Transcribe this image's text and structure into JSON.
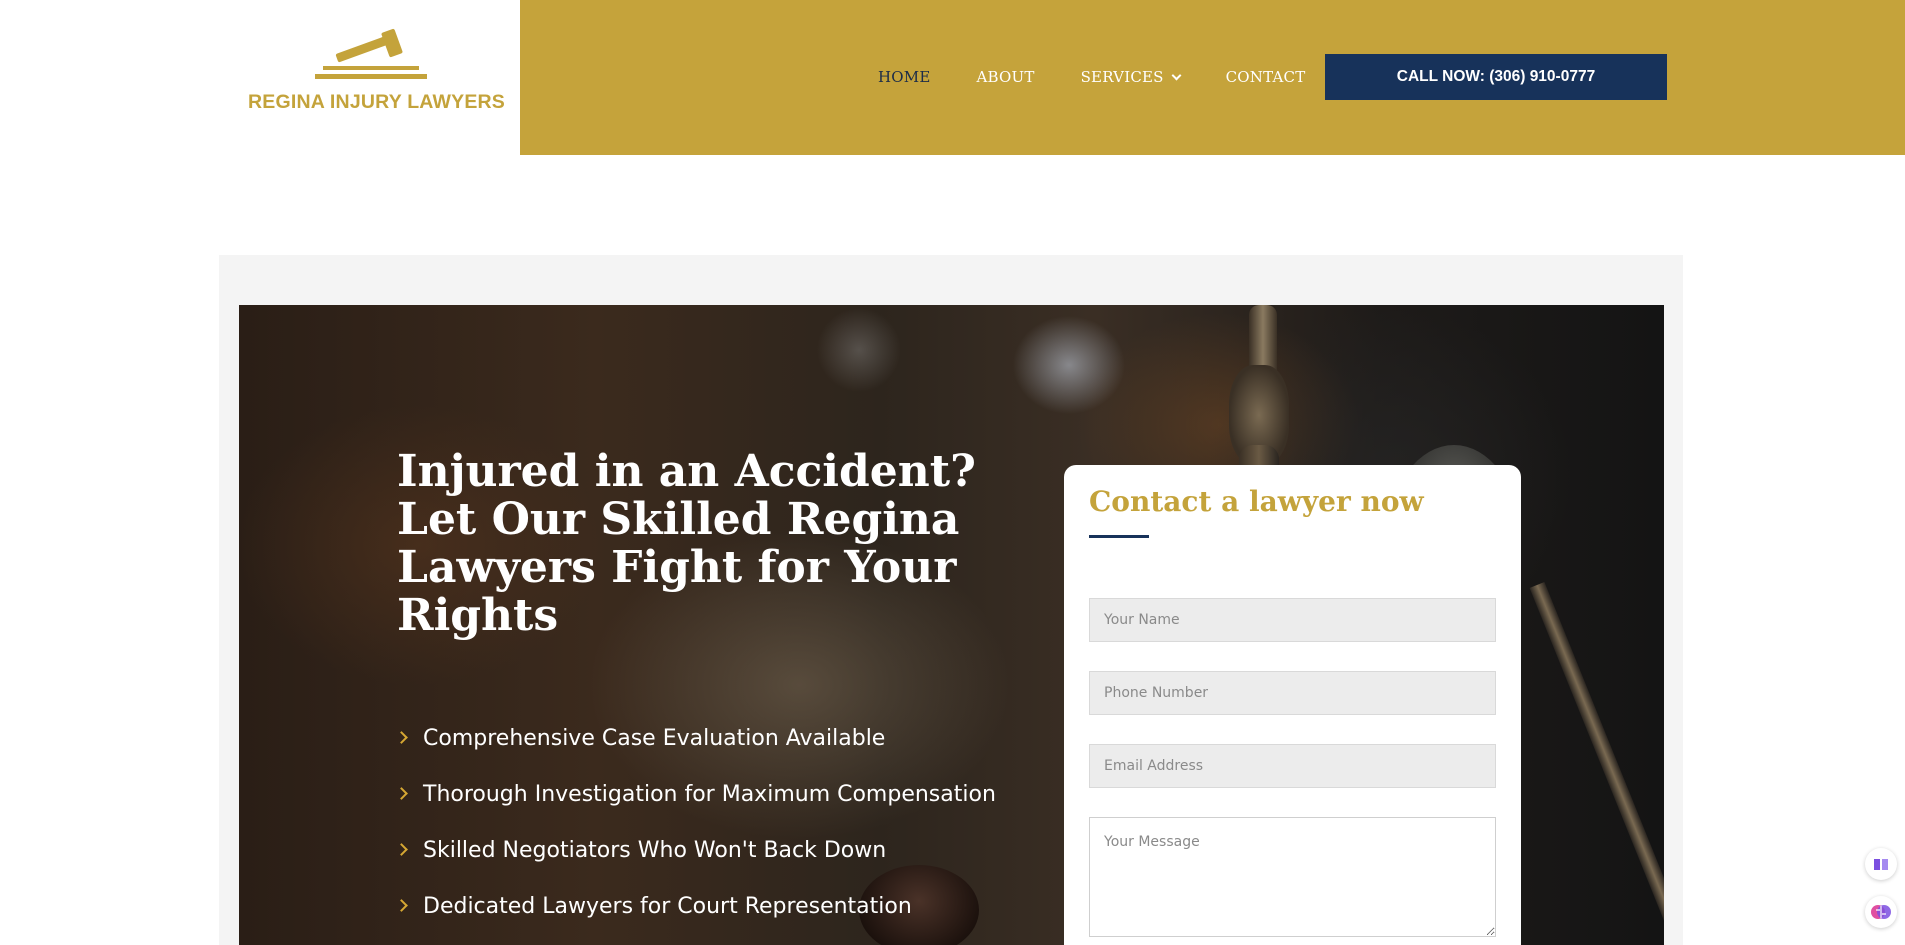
{
  "brand": {
    "name": "REGINA INJURY LAWYERS",
    "logo_icon": "gavel-icon",
    "brand_color": "#c5a33b",
    "navy": "#17325a"
  },
  "nav": {
    "items": [
      {
        "label": "HOME",
        "active": true
      },
      {
        "label": "ABOUT",
        "active": false
      },
      {
        "label": "SERVICES",
        "active": false,
        "has_dropdown": true
      },
      {
        "label": "CONTACT",
        "active": false
      }
    ],
    "cta_label": "CALL NOW: (306) 910-0777"
  },
  "hero": {
    "title": "Injured in an Accident? Let Our Skilled Regina Lawyers Fight for Your Rights",
    "benefits": [
      "Comprehensive Case Evaluation Available",
      "Thorough Investigation for Maximum Compensation",
      "Skilled Negotiators Who Won't Back Down",
      "Dedicated Lawyers for Court Representation"
    ]
  },
  "form": {
    "title": "Contact a lawyer now",
    "name_placeholder": "Your Name",
    "phone_placeholder": "Phone Number",
    "email_placeholder": "Email Address",
    "message_placeholder": "Your Message"
  },
  "widgets": {
    "book_icon": "book-icon",
    "brain_icon": "brain-icon"
  }
}
